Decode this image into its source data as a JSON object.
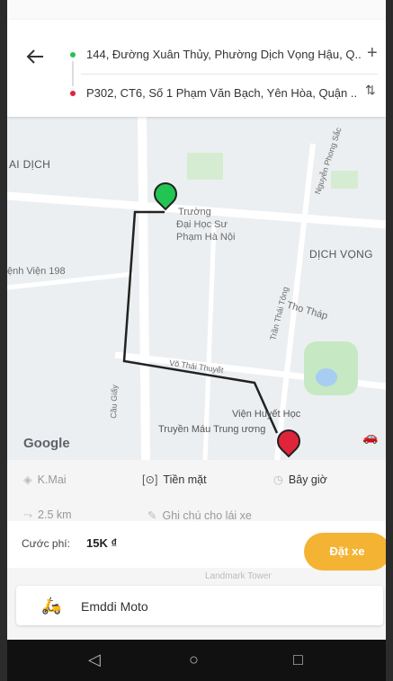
{
  "header": {
    "back_icon": "arrow-left-icon",
    "origin": "144, Đường Xuân Thủy, Phường Dịch Vọng Hậu, Q..",
    "destination": "P302, CT6, Số 1 Phạm Văn Bạch, Yên Hòa, Quận ..",
    "add_icon": "plus-icon",
    "swap_icon": "swap-icon"
  },
  "map": {
    "labels": [
      "AI DỊCH",
      "Trường",
      "Đại Học Sư",
      "Phạm Hà Nội",
      "DỊCH VỌNG",
      "ệnh Viện 198",
      "Tho Tháp",
      "Viện Huyết Học",
      "Truyền Máu Trung ương",
      "Nguyễn Phong Sắc",
      "Cầu Giấy",
      "Trần Thái Tông",
      "Võ Thái Thuyết",
      "Google"
    ]
  },
  "options": {
    "promo": "K.Mai",
    "payment": "Tiền mặt",
    "time": "Bây giờ",
    "distance": "2.5 km",
    "note_placeholder": "Ghi chú cho lái xe"
  },
  "fare": {
    "label": "Cước phí:",
    "value": "15K ₫",
    "book_label": "Đặt xe"
  },
  "vehicle": {
    "name": "Emddi Moto",
    "behind_text": "Landmark Tower"
  },
  "colors": {
    "accent": "#f5b334",
    "origin": "#22c25a",
    "destination": "#e0243a"
  }
}
